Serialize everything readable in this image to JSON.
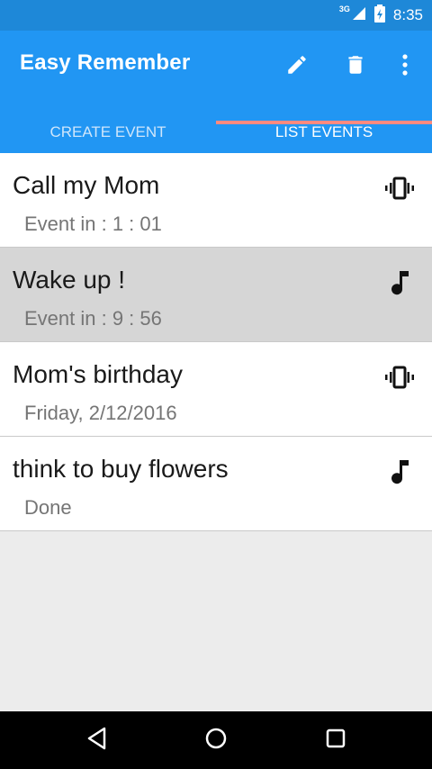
{
  "status_bar": {
    "network": "3G",
    "time": "8:35"
  },
  "app_bar": {
    "title": "Easy Remember",
    "actions": {
      "edit": "edit-icon",
      "delete": "delete-icon",
      "more": "more-vert-icon"
    }
  },
  "tabs": [
    {
      "label": "CREATE EVENT",
      "active": false
    },
    {
      "label": "LIST EVENTS",
      "active": true
    }
  ],
  "events": [
    {
      "title": "Call my Mom",
      "subtitle": "Event in : 1 : 01",
      "alert_icon": "vibrate-icon",
      "selected": false
    },
    {
      "title": "Wake up !",
      "subtitle": "Event in : 9 : 56",
      "alert_icon": "music-note-icon",
      "selected": true
    },
    {
      "title": "Mom's birthday",
      "subtitle": "Friday, 2/12/2016",
      "alert_icon": "vibrate-icon",
      "selected": false
    },
    {
      "title": "think to buy flowers",
      "subtitle": "Done",
      "alert_icon": "music-note-icon",
      "selected": false
    }
  ],
  "colors": {
    "primary": "#2196f3",
    "primary_dark": "#1e88d8",
    "tab_indicator": "#ff8a80",
    "selected_row": "#d6d6d6"
  },
  "nav_bar": {
    "back": "back-icon",
    "home": "home-icon",
    "recents": "recents-icon"
  }
}
